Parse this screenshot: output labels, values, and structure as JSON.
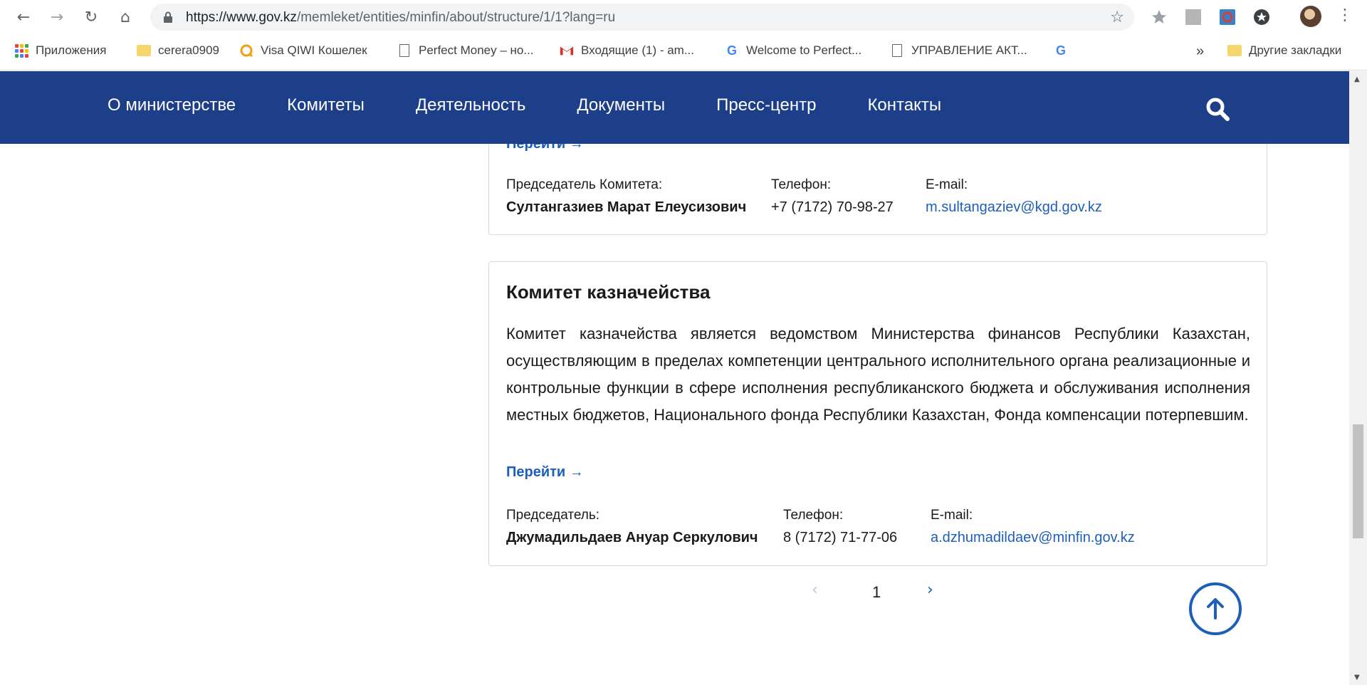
{
  "browser": {
    "url_host": "https://www.gov.kz",
    "url_path": "/memleket/entities/minfin/about/structure/1/1?lang=ru",
    "nav_icons": [
      "back-icon",
      "forward-icon",
      "reload-icon",
      "home-icon"
    ],
    "bookmarks": [
      {
        "label": "Приложения",
        "icon": "apps-icon"
      },
      {
        "label": "cerera0909",
        "icon": "folder-icon"
      },
      {
        "label": "Visa QIWI Кошелек",
        "icon": "qiwi-icon"
      },
      {
        "label": "Perfect Money – но...",
        "icon": "page-icon"
      },
      {
        "label": "Входящие (1) - am...",
        "icon": "gmail-icon"
      },
      {
        "label": "Welcome to Perfect...",
        "icon": "google-icon"
      },
      {
        "label": "УПРАВЛЕНИЕ АКТ...",
        "icon": "page-icon"
      }
    ],
    "more_bookmarks": "»",
    "other_bookmarks": "Другие закладки"
  },
  "site": {
    "nav": [
      "О министерстве",
      "Комитеты",
      "Деятельность",
      "Документы",
      "Пресс-центр",
      "Контакты"
    ],
    "brand_color": "#1d3f8a",
    "link_color": "#1d5fb8"
  },
  "cards": [
    {
      "goto": "Перейти →",
      "chair_label": "Председатель Комитета:",
      "chair_name": "Султангазиев Марат Елеусизович",
      "phone_label": "Телефон:",
      "phone": "+7 (7172) 70-98-27",
      "email_label": "E-mail:",
      "email": "m.sultangaziev@kgd.gov.kz"
    },
    {
      "title": "Комитет казначейства",
      "description": "Комитет казначейства является ведомством Министерства финансов Республики Казахстан, осуществляющим в пределах компетенции центрального исполнительного органа реализационные и контрольные функции в сфере исполнения республиканского бюджета и обслуживания исполнения местных бюджетов, Национального фонда Республики Казахстан, Фонда компенсации потерпевшим.",
      "goto": "Перейти →",
      "chair_label": "Председатель:",
      "chair_name": "Джумадильдаев Ануар Серкулович",
      "phone_label": "Телефон:",
      "phone": "8 (7172) 71-77-06",
      "email_label": "E-mail:",
      "email": "a.dzhumadildaev@minfin.gov.kz"
    }
  ],
  "pagination": {
    "prev": "‹",
    "current_page": "1",
    "next": "›"
  }
}
